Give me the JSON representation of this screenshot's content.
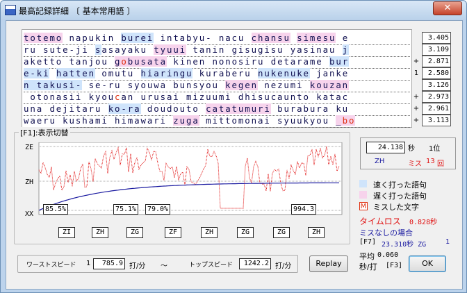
{
  "window": {
    "title": "最高記録詳細 〔 基本常用語 〕",
    "close_glyph": "✕"
  },
  "lines": [
    {
      "segs": [
        {
          "t": "totemo",
          "s": "slow"
        },
        {
          "t": " napukin "
        },
        {
          "t": "burei",
          "s": "fast"
        },
        {
          "t": " intabyu- nacu "
        },
        {
          "t": "chansu",
          "s": "slow"
        },
        {
          "t": " "
        },
        {
          "t": "simesu",
          "s": "slow"
        },
        {
          "t": " e"
        }
      ]
    },
    {
      "segs": [
        {
          "t": "ru sute-ji "
        },
        {
          "t": "s",
          "s": "fast"
        },
        {
          "t": "asayaku "
        },
        {
          "t": "tyuui",
          "s": "slow"
        },
        {
          "t": " tanin gisugisu yasinau "
        },
        {
          "t": "j",
          "s": "fast"
        }
      ]
    },
    {
      "segs": [
        {
          "t": "aketto tanjou "
        },
        {
          "t": "g",
          "s": "slow"
        },
        {
          "t": "o",
          "s": "slow",
          "m": true
        },
        {
          "t": "busata",
          "s": "slow"
        },
        {
          "t": " kinen nonosiru detarame "
        },
        {
          "t": "bur",
          "s": "fast"
        }
      ]
    },
    {
      "segs": [
        {
          "t": "e-ki",
          "s": "fast"
        },
        {
          "t": " "
        },
        {
          "t": "hatten",
          "s": "fast"
        },
        {
          "t": " omutu "
        },
        {
          "t": "hiaringu",
          "s": "fast"
        },
        {
          "t": " kuraberu "
        },
        {
          "t": "nukenuke",
          "s": "fast"
        },
        {
          "t": " janke"
        }
      ]
    },
    {
      "segs": [
        {
          "t": "n takusi-",
          "s": "fast"
        },
        {
          "t": " se-ru syouwa bunsyou "
        },
        {
          "t": "kegen",
          "s": "slow"
        },
        {
          "t": " nezumi "
        },
        {
          "t": "kouzan",
          "s": "slow"
        }
      ]
    },
    {
      "segs": [
        {
          "t": " otonasii kyou"
        },
        {
          "t": "c",
          "s": null,
          "m": true
        },
        {
          "t": "an urusai mizuumi dhisucaunto katac"
        }
      ]
    },
    {
      "segs": [
        {
          "t": "una dejitaru "
        },
        {
          "t": "ko-ra",
          "s": "fast"
        },
        {
          "t": " doudouto "
        },
        {
          "t": "catatumuri",
          "s": "slow"
        },
        {
          "t": " burabura ku"
        }
      ]
    },
    {
      "segs": [
        {
          "t": "waeru kushami himawari "
        },
        {
          "t": "zuga",
          "s": "slow"
        },
        {
          "t": " mittomonai syuukyou "
        },
        {
          "t": "_",
          "s": "slow"
        },
        {
          "t": "bo",
          "s": "slow",
          "m": true
        }
      ]
    }
  ],
  "line_marks": [
    "",
    "",
    "+",
    "1",
    "",
    "+",
    "+",
    "+"
  ],
  "line_scores": [
    "3.405",
    "3.109",
    "2.871",
    "2.580",
    "3.126",
    "2.973",
    "2.961",
    "3.113"
  ],
  "graph": {
    "group_label": "[F1]:表示切替",
    "y_labels": [
      "ZE",
      "ZH",
      "XX"
    ],
    "speed_labels": [
      "85.5%",
      "75.1%",
      "79.0%",
      "994.3"
    ],
    "ranks": [
      "ZI",
      "ZH",
      "ZG",
      "ZF",
      "ZH",
      "ZG",
      "ZG",
      "ZH"
    ]
  },
  "stats": {
    "time": "24.138",
    "time_unit": "秒",
    "place": "1位",
    "rank": "ZH",
    "miss_label": "ミス",
    "miss_count": "13",
    "miss_unit": "回"
  },
  "legend": {
    "fast": "速く打った語句",
    "slow": "遅く打った語句",
    "miss_mark": "M",
    "miss": "ミスした文字",
    "timeloss_label": "タイムロス",
    "timeloss_value": "0.828秒",
    "nomiss_label": "ミスなしの場合",
    "nomiss_key": "[F7]",
    "nomiss_value": "23.310秒 ZG",
    "nomiss_place": "1",
    "avg_label": "平均",
    "avg_value": "0.060",
    "avg_unit": "秒/打",
    "avg_key": "[F3]"
  },
  "speed": {
    "worst_label": "ワーストスピード",
    "worst_rank": "1",
    "worst_value": "785.9",
    "worst_unit": "打/分",
    "tilde": "〜",
    "top_label": "トップスピード",
    "top_value": "1242.2",
    "top_unit": "打/分"
  },
  "buttons": {
    "replay": "Replay",
    "ok": "OK"
  },
  "colors": {
    "fast": "#cfe4fb",
    "slow": "#f7d3ec",
    "miss": "#e03010"
  }
}
